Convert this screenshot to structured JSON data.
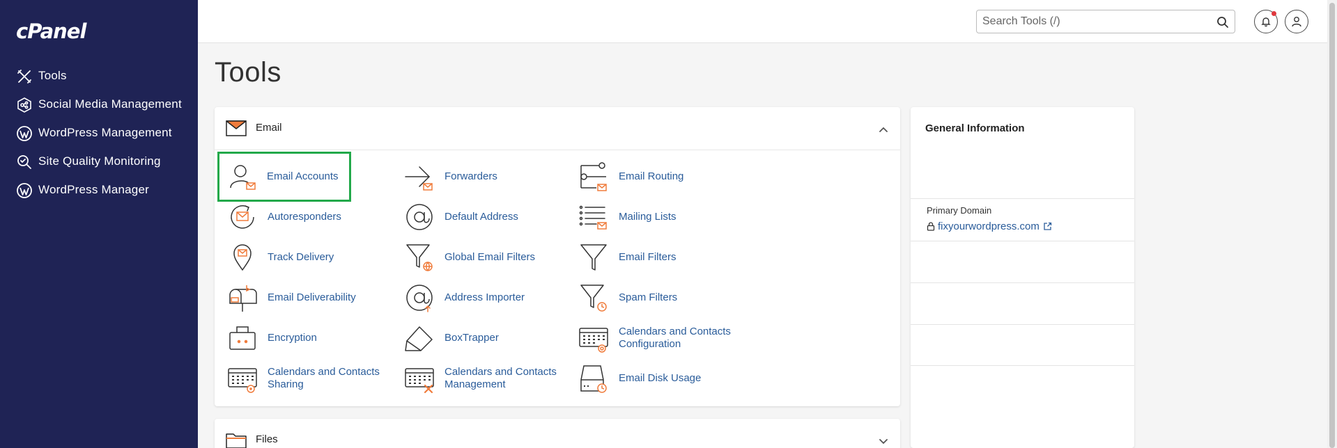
{
  "app": {
    "logo": "cPanel"
  },
  "sidebar": {
    "items": [
      {
        "label": "Tools",
        "icon": "tools-icon"
      },
      {
        "label": "Social Media Management",
        "icon": "social-media-icon"
      },
      {
        "label": "WordPress Management",
        "icon": "wordpress-icon"
      },
      {
        "label": "Site Quality Monitoring",
        "icon": "site-quality-icon"
      },
      {
        "label": "WordPress Manager",
        "icon": "wordpress-icon"
      }
    ]
  },
  "header": {
    "search_placeholder": "Search Tools (/)",
    "notification_dot_color": "#e0393e"
  },
  "page": {
    "title": "Tools"
  },
  "email_section": {
    "title": "Email",
    "tools": [
      {
        "label": "Email Accounts",
        "icon": "email-accounts-icon",
        "selected": true
      },
      {
        "label": "Forwarders",
        "icon": "forwarders-icon"
      },
      {
        "label": "Email Routing",
        "icon": "email-routing-icon"
      },
      {
        "label": "Autoresponders",
        "icon": "autoresponders-icon"
      },
      {
        "label": "Default Address",
        "icon": "default-address-icon"
      },
      {
        "label": "Mailing Lists",
        "icon": "mailing-lists-icon"
      },
      {
        "label": "Track Delivery",
        "icon": "track-delivery-icon"
      },
      {
        "label": "Global Email Filters",
        "icon": "global-email-filters-icon"
      },
      {
        "label": "Email Filters",
        "icon": "email-filters-icon"
      },
      {
        "label": "Email Deliverability",
        "icon": "email-deliverability-icon"
      },
      {
        "label": "Address Importer",
        "icon": "address-importer-icon"
      },
      {
        "label": "Spam Filters",
        "icon": "spam-filters-icon"
      },
      {
        "label": "Encryption",
        "icon": "encryption-icon"
      },
      {
        "label": "BoxTrapper",
        "icon": "boxtrapper-icon"
      },
      {
        "label": "Calendars and Contacts Configuration",
        "icon": "calendar-config-icon"
      },
      {
        "label": "Calendars and Contacts Sharing",
        "icon": "calendar-sharing-icon"
      },
      {
        "label": "Calendars and Contacts Management",
        "icon": "calendar-management-icon"
      },
      {
        "label": "Email Disk Usage",
        "icon": "email-disk-usage-icon"
      }
    ]
  },
  "files_section": {
    "title": "Files"
  },
  "general_info": {
    "title": "General Information",
    "primary_domain_label": "Primary Domain",
    "primary_domain_value": "fixyourwordpress.com"
  },
  "colors": {
    "sidebar_bg": "#1f2355",
    "link": "#2a5c9a",
    "accent_orange": "#f07c3c",
    "selection_green": "#22a94a"
  }
}
